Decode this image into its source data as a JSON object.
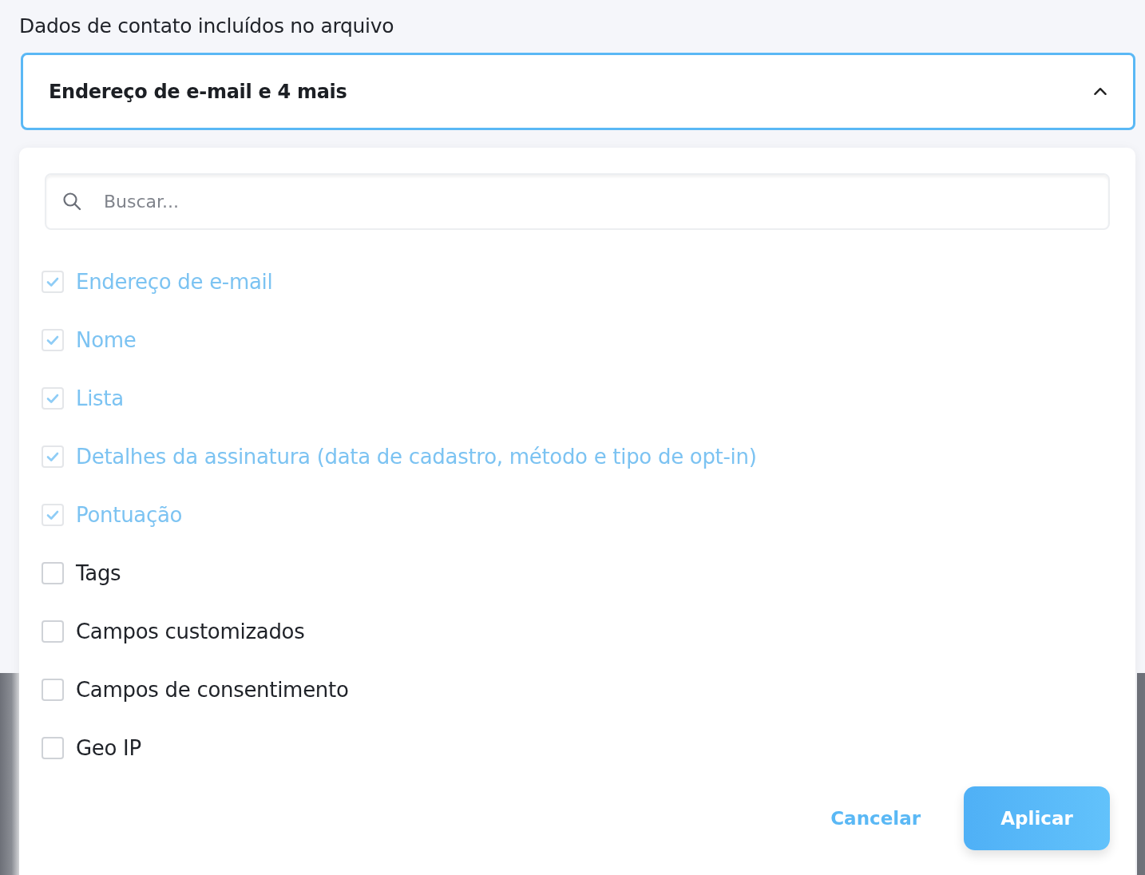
{
  "field_label": "Dados de contato incluídos no arquivo",
  "select": {
    "value": "Endereço de e-mail e 4 mais",
    "expanded": true
  },
  "search": {
    "placeholder": "Buscar..."
  },
  "options": [
    {
      "label": "Endereço de e-mail",
      "checked": true,
      "disabled": true
    },
    {
      "label": "Nome",
      "checked": true,
      "disabled": true
    },
    {
      "label": "Lista",
      "checked": true,
      "disabled": true
    },
    {
      "label": "Detalhes da assinatura (data de cadastro, método e tipo de opt-in)",
      "checked": true,
      "disabled": true
    },
    {
      "label": "Pontuação",
      "checked": true,
      "disabled": true
    },
    {
      "label": "Tags",
      "checked": false,
      "disabled": false
    },
    {
      "label": "Campos customizados",
      "checked": false,
      "disabled": false
    },
    {
      "label": "Campos de consentimento",
      "checked": false,
      "disabled": false
    },
    {
      "label": "Geo IP",
      "checked": false,
      "disabled": false
    }
  ],
  "buttons": [
    {
      "label": "Cancelar",
      "kind": "link"
    },
    {
      "label": "Aplicar",
      "kind": "primary"
    }
  ]
}
